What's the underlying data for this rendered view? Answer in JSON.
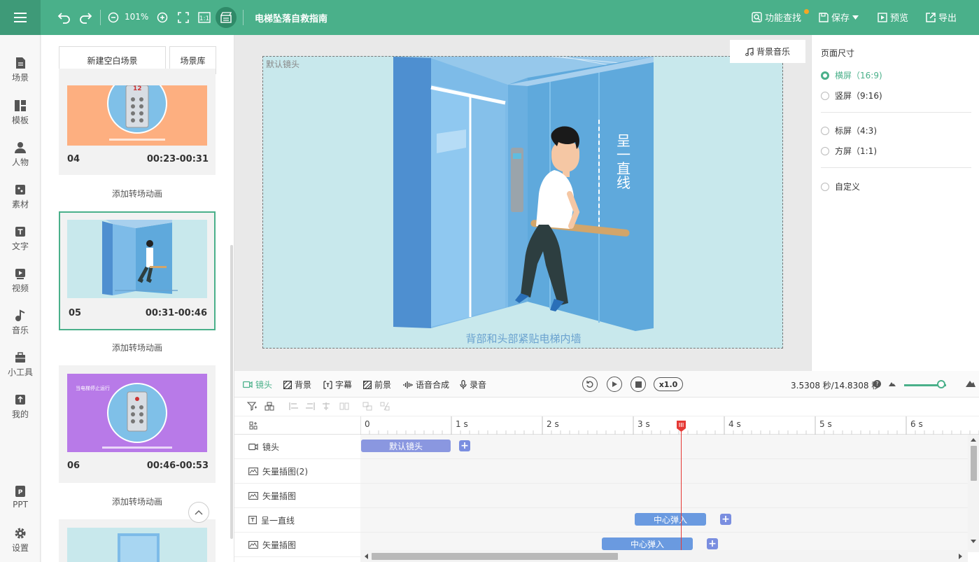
{
  "topbar": {
    "zoom": "101%",
    "doc_title": "电梯坠落自救指南",
    "find_label": "功能查找",
    "save_label": "保存",
    "preview_label": "预览",
    "export_label": "导出"
  },
  "nav": [
    "场景",
    "模板",
    "人物",
    "素材",
    "文字",
    "视频",
    "音乐",
    "小工具",
    "我的",
    "PPT",
    "设置"
  ],
  "scene_panel": {
    "new_scene": "新建空白场景",
    "library": "场景库",
    "transition": "添加转场动画",
    "scenes": [
      {
        "num": "04",
        "time": "00:23-00:31"
      },
      {
        "num": "05",
        "time": "00:31-00:46"
      },
      {
        "num": "06",
        "time": "00:46-00:53"
      }
    ],
    "thumb6_text": "当电梯停止运行",
    "thumb4_floor": "12"
  },
  "canvas": {
    "stage_label": "默认镜头",
    "bgm_label": "背景音乐",
    "caption": "背部和头部紧贴电梯内墙",
    "vertical_text": [
      "呈",
      "一",
      "直",
      "线"
    ]
  },
  "page_size": {
    "title": "页面尺寸",
    "options": [
      "横屏（16:9)",
      "竖屏（9:16)",
      "标屏（4:3)",
      "方屏（1:1)",
      "自定义"
    ],
    "selected": 0
  },
  "timeline": {
    "tabs": [
      "镜头",
      "背景",
      "字幕",
      "前景",
      "语音合成",
      "录音"
    ],
    "speed": "x1.0",
    "time": "3.5308 秒/14.8308 秒",
    "help": "?",
    "ruler": [
      "0",
      "1 s",
      "2 s",
      "3 s",
      "4 s",
      "5 s",
      "6 s"
    ],
    "tracks": [
      {
        "label": "镜头",
        "icon": "camera",
        "clip": "默认镜头"
      },
      {
        "label": "矢量插图(2)",
        "icon": "vector"
      },
      {
        "label": "矢量插图",
        "icon": "vector"
      },
      {
        "label": "呈一直线",
        "icon": "text",
        "clip": "中心弹入"
      },
      {
        "label": "矢量插图",
        "icon": "vector",
        "clip": "中心弹入"
      }
    ],
    "playhead_seconds": 3.5308,
    "duration_seconds": 14.8308
  },
  "colors": {
    "brand": "#4ab08a",
    "clip_lens": "#8a97e0",
    "clip_anim": "#6a9ae0",
    "playhead": "#e53935"
  }
}
